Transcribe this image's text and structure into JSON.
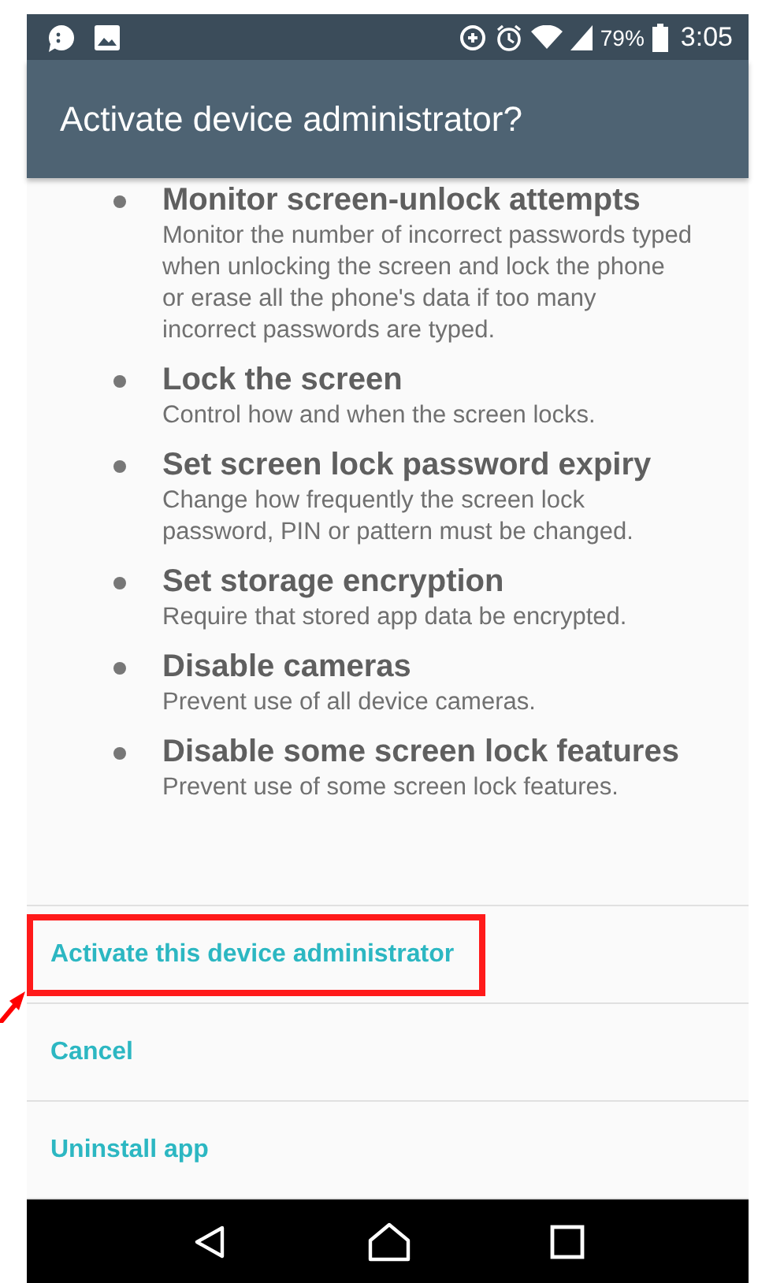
{
  "status_bar": {
    "time": "3:05",
    "battery": "79%"
  },
  "dialog": {
    "title": "Activate device administrator?",
    "permissions": [
      {
        "title": "Monitor screen-unlock attempts",
        "description": "Monitor the number of incorrect passwords typed when unlocking the screen and lock the phone or erase all the phone's data if too many incorrect passwords are typed."
      },
      {
        "title": "Lock the screen",
        "description": "Control how and when the screen locks."
      },
      {
        "title": "Set screen lock password expiry",
        "description": "Change how frequently the screen lock password, PIN or pattern must be changed."
      },
      {
        "title": "Set storage encryption",
        "description": "Require that stored app data be encrypted."
      },
      {
        "title": "Disable cameras",
        "description": "Prevent use of all device cameras."
      },
      {
        "title": "Disable some screen lock features",
        "description": "Prevent use of some screen lock features."
      }
    ],
    "actions": [
      {
        "label": "Activate this device administrator",
        "highlighted": true
      },
      {
        "label": "Cancel",
        "highlighted": false
      },
      {
        "label": "Uninstall app",
        "highlighted": false
      }
    ]
  }
}
